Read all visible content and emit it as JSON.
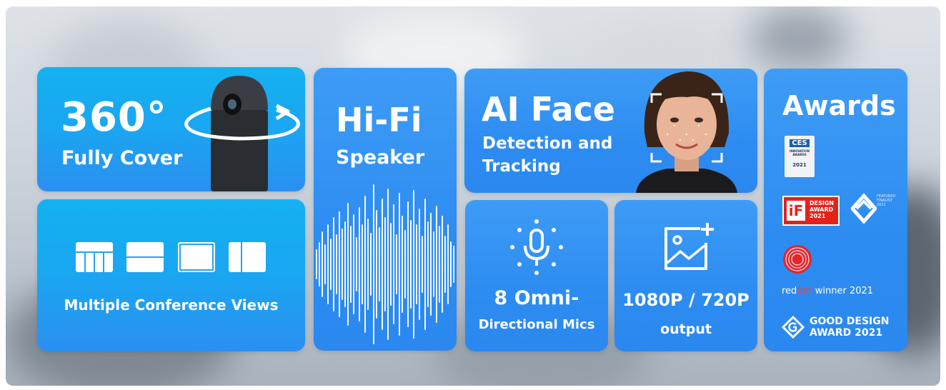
{
  "cards": {
    "coverage": {
      "headline": "360°",
      "subline": "Fully Cover"
    },
    "views": {
      "label": "Multiple Conference Views"
    },
    "speaker": {
      "headline": "Hi-Fi",
      "subline": "Speaker"
    },
    "face": {
      "headline": "AI Face",
      "line1": "Detection and",
      "line2": "Tracking"
    },
    "mics": {
      "line1": "8 Omni-",
      "line2": "Directional Mics"
    },
    "resolution": {
      "line1": "1080P / 720P",
      "line2": "output"
    },
    "awards": {
      "title": "Awards",
      "ces": {
        "brand": "CES",
        "line1": "INNOVATION",
        "line2": "AWARDS",
        "year": "2021"
      },
      "if": {
        "brand": "iF",
        "line1": "DESIGN",
        "line2": "AWARD",
        "year": "2021"
      },
      "featured": {
        "line1": "FEATURED",
        "line2": "FINALIST",
        "year": "2021"
      },
      "reddot": {
        "red": "red",
        "dot": "dot",
        "rest": " winner 2021"
      },
      "gooddesign": {
        "line1": "GOOD DESIGN",
        "line2": "AWARD 2021"
      }
    }
  },
  "colors": {
    "card_blue": "#2d8cf1",
    "card_cyan": "#14b1f0",
    "reddot_red": "#e3262b",
    "if_red": "#e2231a"
  },
  "icons": [
    "camera-device",
    "rotate-arrow",
    "grid-view-icon",
    "split-view-icon",
    "frame-view-icon",
    "side-by-side-icon",
    "waveform",
    "face-portrait",
    "microphone-icon",
    "image-plus-icon",
    "ces-badge",
    "if-badge",
    "featured-finalist-badge",
    "reddot-logo",
    "good-design-logo"
  ]
}
